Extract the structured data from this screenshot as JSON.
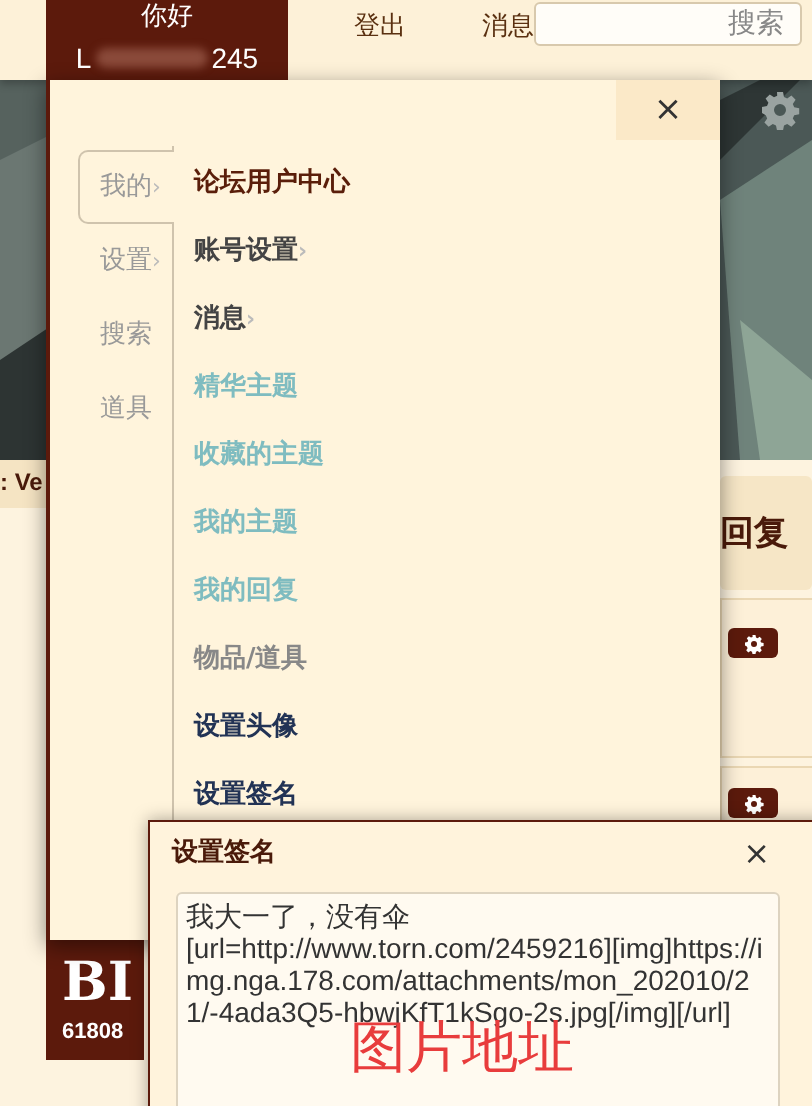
{
  "top_bar": {
    "greeting": "你好",
    "username_start": "L",
    "username_end": "245",
    "links": [
      "登出",
      "消息"
    ],
    "search": {
      "placeholder": "搜索"
    }
  },
  "background": {
    "partial_title": ": Ve",
    "reply_label": "回复",
    "badge_title": "BI",
    "badge_number": "61808"
  },
  "menu": {
    "close": "×",
    "tabs": [
      {
        "label": "我的",
        "arrow": "›",
        "selected": true
      },
      {
        "label": "设置",
        "arrow": "›",
        "selected": false
      },
      {
        "label": "搜索",
        "selected": false
      },
      {
        "label": "道具",
        "selected": false
      }
    ],
    "items": [
      {
        "label": "论坛用户中心",
        "kind": "header"
      },
      {
        "label": "账号设置",
        "arrow": "›",
        "kind": "submenu"
      },
      {
        "label": "消息",
        "arrow": "›",
        "kind": "submenu"
      },
      {
        "label": "精华主题",
        "kind": "link"
      },
      {
        "label": "收藏的主题",
        "kind": "link"
      },
      {
        "label": "我的主题",
        "kind": "link"
      },
      {
        "label": "我的回复",
        "kind": "link"
      },
      {
        "label": "物品/道具",
        "kind": "muted"
      },
      {
        "label": "设置头像",
        "kind": "plain"
      },
      {
        "label": "设置签名",
        "kind": "plain"
      }
    ]
  },
  "dialog": {
    "title": "设置签名",
    "close": "×",
    "text": "我大一了，没有伞\n[url=http://www.torn.com/2459216][img]https://img.nga.178.com/attachments/mon_202010/21/-4ada3Q5-hbwjKfT1kSgo-2s.jpg[/img][/url]",
    "annotation": "图片地址"
  }
}
